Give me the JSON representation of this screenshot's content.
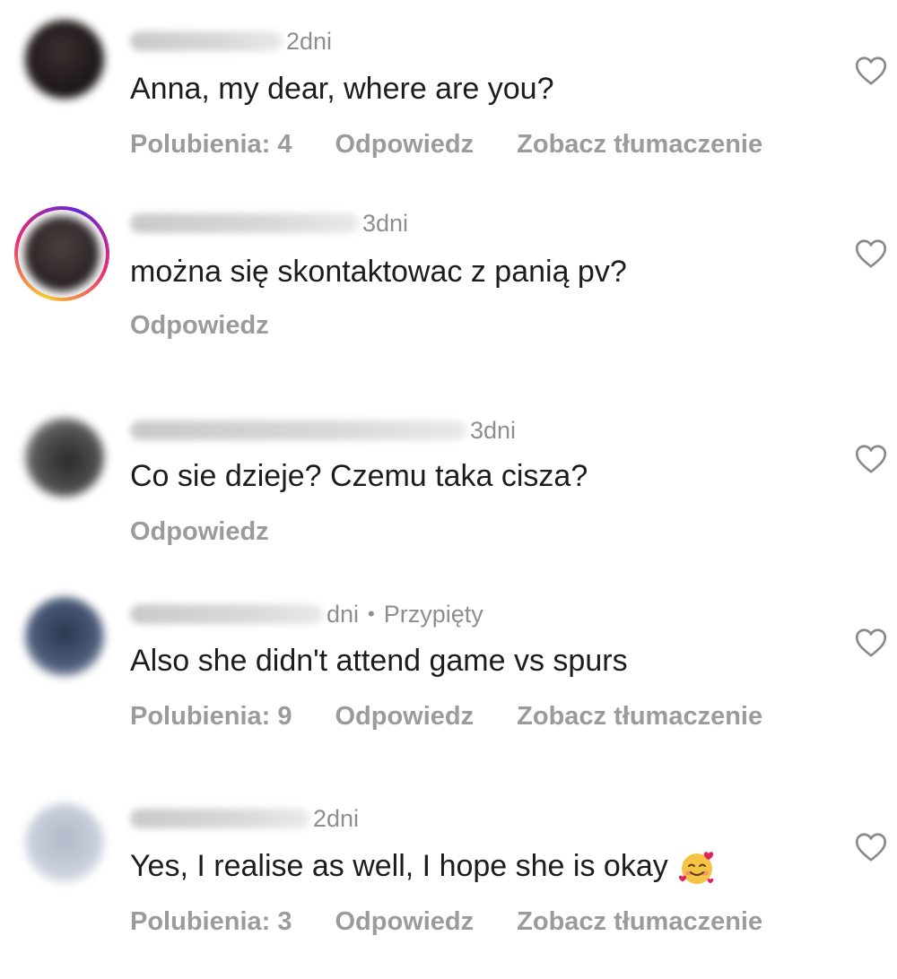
{
  "comments": [
    {
      "time": "2dni",
      "text": "Anna, my dear, where are you?",
      "likes": "Polubienia: 4",
      "reply": "Odpowiedz",
      "translate": "Zobacz tłumaczenie"
    },
    {
      "time": "3dni",
      "text": "można się skontaktowac z panią pv?",
      "reply": "Odpowiedz"
    },
    {
      "time": "3dni",
      "text": "Co sie dzieje? Czemu taka cisza?",
      "reply": "Odpowiedz"
    },
    {
      "time": "dni",
      "pinned": "Przypięty",
      "text": "Also she didn't attend game vs spurs",
      "likes": "Polubienia: 9",
      "reply": "Odpowiedz",
      "translate": "Zobacz tłumaczenie"
    },
    {
      "time": "2dni",
      "text": "Yes, I realise as well, I hope she is okay",
      "emoji": "smiling-face-with-hearts-emoji",
      "likes": "Polubienia: 3",
      "reply": "Odpowiedz",
      "translate": "Zobacz tłumaczenie"
    }
  ],
  "icons": {
    "like": "heart-outline-icon"
  },
  "colors": {
    "primary_text": "#1c1c1c",
    "secondary_text": "#8e8e8e",
    "action_text": "#9b9b9b",
    "story_ring_start": "#f9ce34",
    "story_ring_mid": "#ee2a7b",
    "story_ring_end": "#6228d7"
  }
}
